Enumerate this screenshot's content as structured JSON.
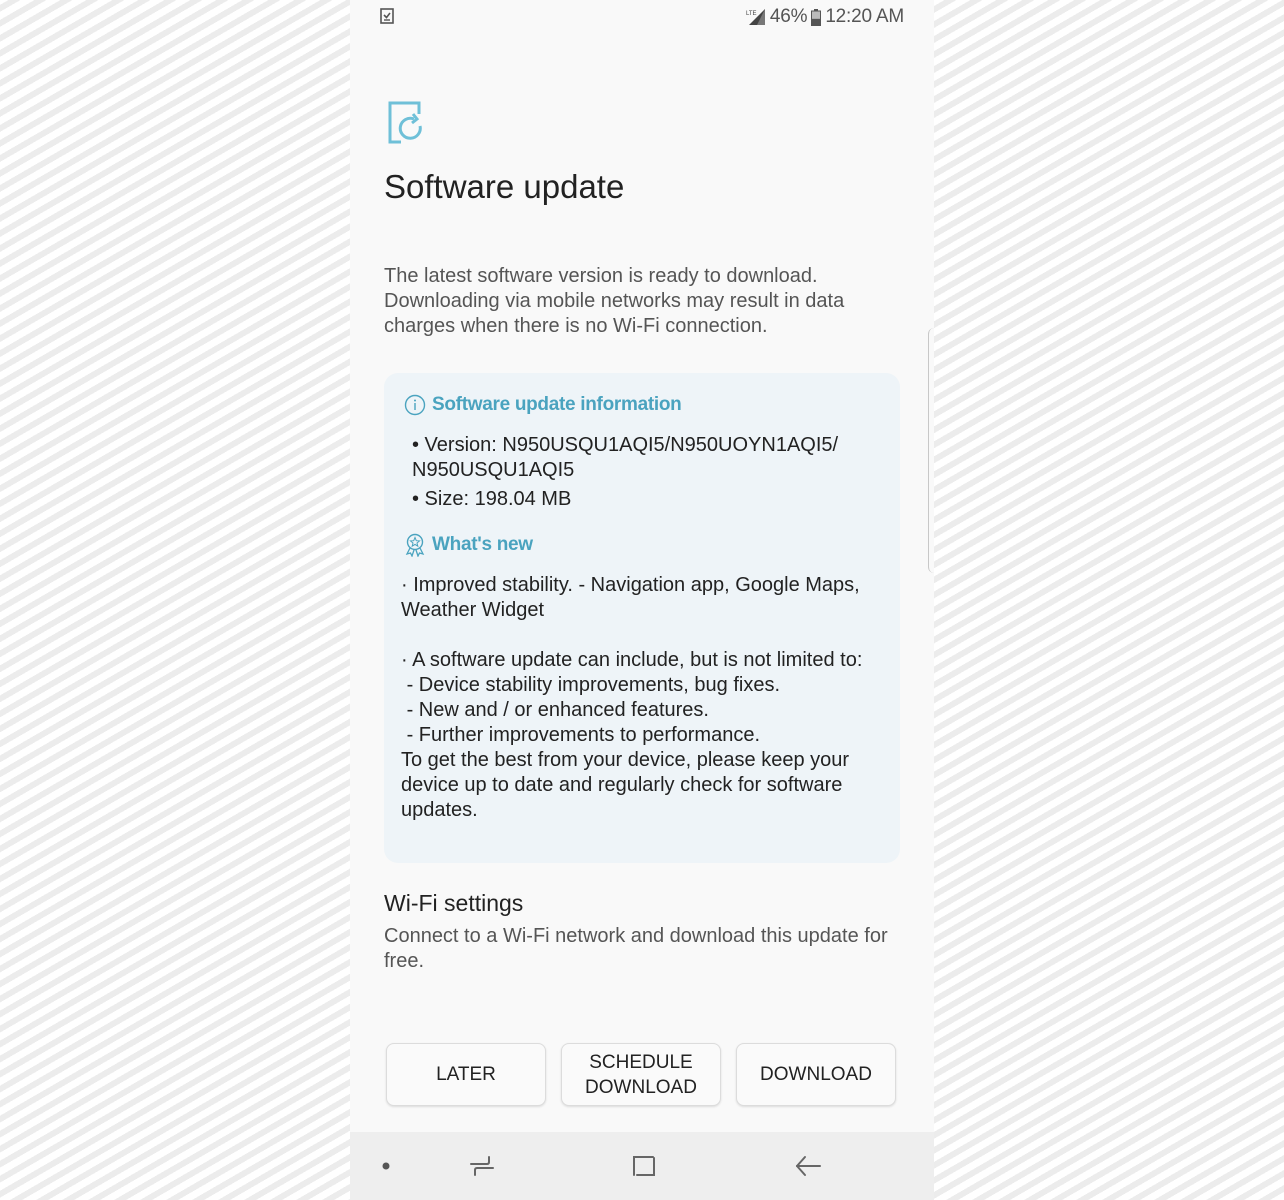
{
  "status_bar": {
    "notification_icon": "task-checklist-icon",
    "network_label": "LTE",
    "battery_percent": "46%",
    "time": "12:20 AM",
    "battery_level": 0.46
  },
  "header": {
    "icon": "software-update-icon",
    "title": "Software update"
  },
  "intro_text": "The latest software version is ready to download. Downloading via mobile networks may result in data charges when there is no Wi-Fi connection.",
  "info_card": {
    "info_heading": "Software update information",
    "info_icon": "info-icon",
    "version_line": "• Version: N950USQU1AQI5/N950UOYN1AQI5/ N950USQU1AQI5",
    "size_line": "• Size: 198.04 MB",
    "whatsnew_heading": "What's new",
    "whatsnew_icon": "award-badge-icon",
    "whatsnew_text": "· Improved stability. - Navigation app, Google Maps, Weather Widget\n\n· A software update can include, but is not limited to:\n - Device stability improvements, bug fixes.\n - New and / or enhanced features.\n - Further improvements to performance.\nTo get the best from your device, please keep your device up to date and regularly check for software updates."
  },
  "wifi": {
    "title": "Wi-Fi settings",
    "description": "Connect to a Wi-Fi network and download this update for free."
  },
  "buttons": {
    "later": "LATER",
    "schedule_line1": "SCHEDULE",
    "schedule_line2": "DOWNLOAD",
    "download": "DOWNLOAD"
  },
  "nav_bar": {
    "items": [
      "dot-indicator",
      "recent-apps",
      "home",
      "back"
    ]
  },
  "colors": {
    "accent": "#4aa3bf",
    "card_background": "#eef4f8",
    "nav_background": "#eeeeee"
  }
}
